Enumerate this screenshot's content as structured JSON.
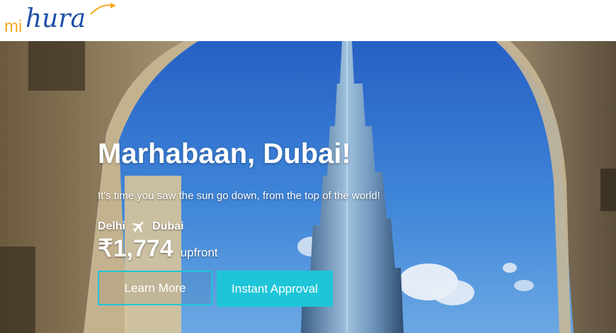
{
  "brand": {
    "logo_mi": "mi",
    "logo_hura": "hura",
    "colors": {
      "mi": "#f2a81d",
      "hura": "#1e4fa8"
    }
  },
  "hero": {
    "headline": "Marhabaan, Dubai!",
    "subline": "It's time you saw the sun go down, from the top of the world!",
    "route": {
      "from": "Delhi",
      "to": "Dubai",
      "icon": "airplane-icon"
    },
    "price": {
      "amount": "₹1,774",
      "suffix": "upfront"
    },
    "buttons": {
      "learn_more": "Learn More",
      "instant_approval": "Instant Approval"
    },
    "accent_color": "#1ec5d8"
  }
}
